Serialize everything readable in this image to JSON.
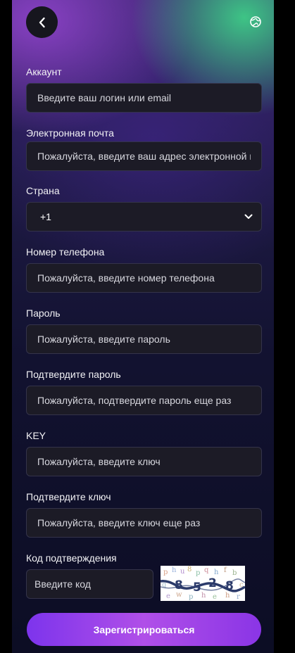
{
  "header": {
    "back_icon": "chevron-left-icon",
    "language_icon": "globe-icon"
  },
  "form": {
    "account": {
      "label": "Аккаунт",
      "placeholder": "Введите ваш логин или email"
    },
    "email": {
      "label": "Электронная почта",
      "placeholder": "Пожалуйста, введите ваш адрес электронной почты"
    },
    "country": {
      "label": "Страна",
      "value": "+1",
      "icon": "chevron-down-icon"
    },
    "phone": {
      "label": "Номер телефона",
      "placeholder": "Пожалуйста, введите номер телефона"
    },
    "password": {
      "label": "Пароль",
      "placeholder": "Пожалуйста, введите пароль"
    },
    "confirm_password": {
      "label": "Подтвердите пароль",
      "placeholder": "Пожалуйста, подтвердите пароль еще раз"
    },
    "key": {
      "label": "KEY",
      "placeholder": "Пожалуйста, введите ключ"
    },
    "confirm_key": {
      "label": "Подтвердите ключ",
      "placeholder": "Пожалуйста, введите ключ еще раз"
    },
    "verification": {
      "label": "Код подтверждения",
      "placeholder": "Введите код",
      "captcha_text": "8528"
    },
    "submit_label": "Зарегистрироваться"
  },
  "colors": {
    "accent_start": "#7d34ec",
    "accent_mid": "#b04fe8",
    "field_bg": "#1c1b26",
    "field_border": "#34334a"
  }
}
